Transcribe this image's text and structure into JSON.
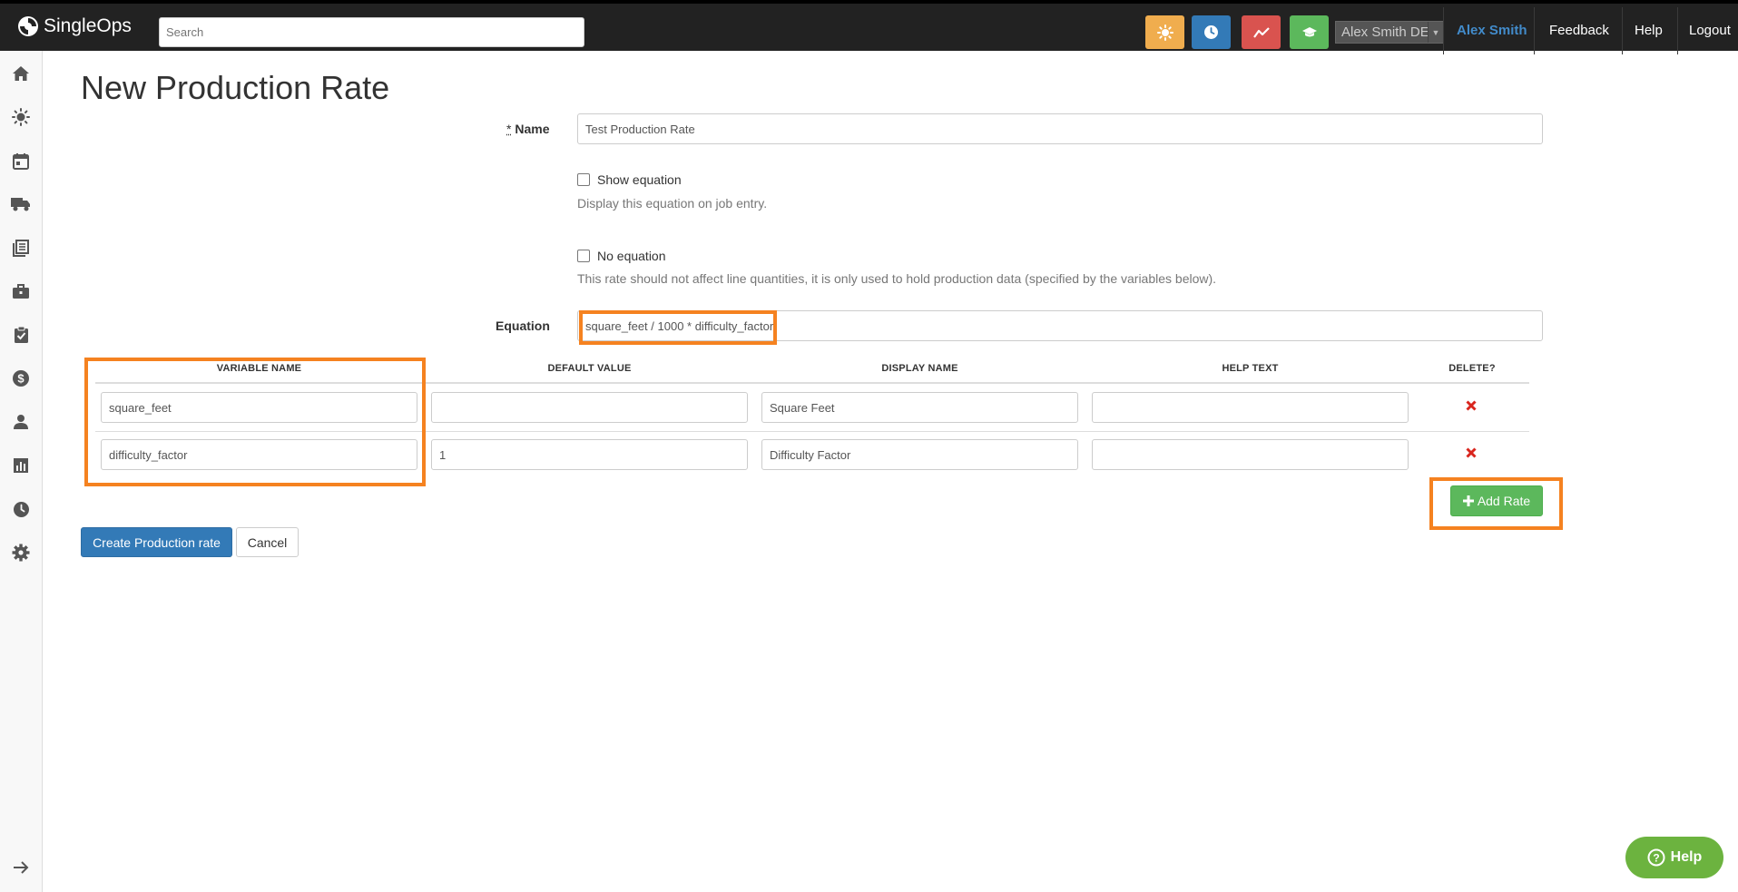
{
  "header": {
    "logo_text": "SingleOps",
    "search_placeholder": "Search",
    "quick_buttons": [
      {
        "icon": "sun-icon",
        "color": "#f0ad4e"
      },
      {
        "icon": "clock-icon",
        "color": "#337ab7"
      },
      {
        "icon": "activity-chart-icon",
        "color": "#d9534f"
      },
      {
        "icon": "graduation-cap-icon",
        "color": "#5cb85c"
      }
    ],
    "account_select_value": "Alex Smith DE",
    "user_name": "Alex Smith",
    "user_name_color": "#428bca",
    "feedback_label": "Feedback",
    "help_label": "Help",
    "logout_label": "Logout"
  },
  "sidebar": {
    "items": [
      "home-icon",
      "sun-icon",
      "calendar-icon",
      "truck-icon",
      "documents-icon",
      "briefcase-icon",
      "clipboard-check-icon",
      "dollar-icon",
      "user-icon",
      "bar-chart-icon",
      "clock-icon",
      "gear-icon"
    ],
    "expand_icon": "arrow-right-icon"
  },
  "page": {
    "title": "New Production Rate"
  },
  "form": {
    "required_mark": "*",
    "name_label": "Name",
    "name_value": "Test Production Rate",
    "show_equation_label": "Show equation",
    "show_equation_checked": false,
    "show_equation_help": "Display this equation on job entry.",
    "no_equation_label": "No equation",
    "no_equation_checked": false,
    "no_equation_help": "This rate should not affect line quantities, it is only used to hold production data (specified by the variables below).",
    "equation_label": "Equation",
    "equation_value": "square_feet / 1000 * difficulty_factor"
  },
  "variables_table": {
    "headers": [
      "VARIABLE NAME",
      "DEFAULT VALUE",
      "DISPLAY NAME",
      "HELP TEXT",
      "DELETE?"
    ],
    "rows": [
      {
        "variable_name": "square_feet",
        "default_value": "",
        "display_name": "Square Feet",
        "help_text": ""
      },
      {
        "variable_name": "difficulty_factor",
        "default_value": "1",
        "display_name": "Difficulty Factor",
        "help_text": ""
      }
    ],
    "delete_icon": "close-x-icon",
    "add_rate_label": "Add Rate"
  },
  "actions": {
    "create_label": "Create Production rate",
    "cancel_label": "Cancel"
  },
  "help_widget": {
    "label": "Help"
  },
  "highlight_color": "#f58220"
}
